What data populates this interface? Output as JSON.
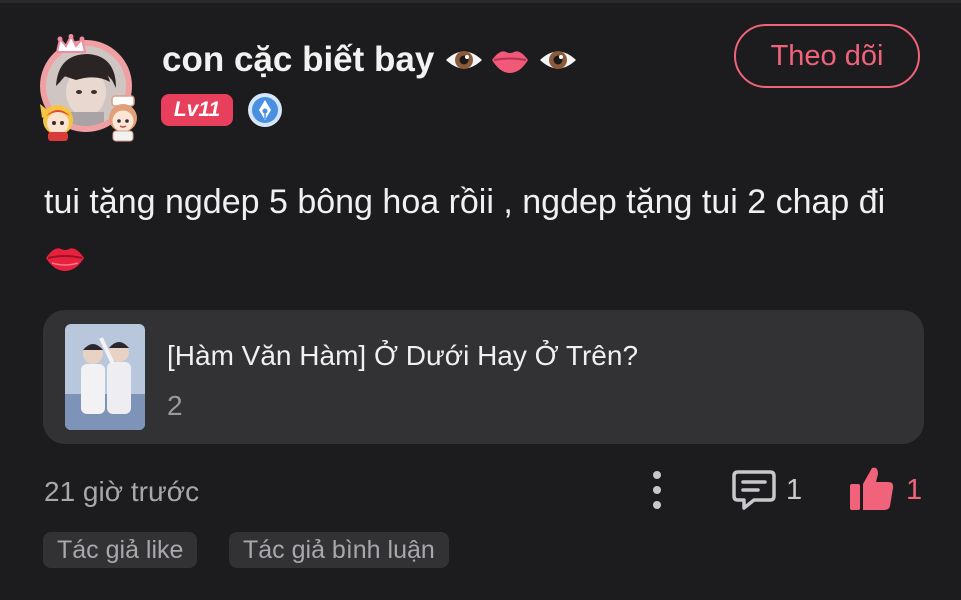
{
  "author": {
    "name": "con cặc biết bay",
    "name_emojis": [
      "eye-icon",
      "lips-icon",
      "eye-icon"
    ],
    "level": "Lv11",
    "verified_icon": "pen-nib-badge-icon"
  },
  "follow": {
    "label": "Theo dõi"
  },
  "post": {
    "text": "tui tặng ngdep 5 bông hoa rồii , ngdep tặng tui 2 chap đi",
    "trailing_emoji": "kiss-mark-icon"
  },
  "work": {
    "title": "[Hàm Văn Hàm] Ở Dưới Hay Ở Trên?",
    "chapter": "2"
  },
  "footer": {
    "time": "21 giờ trước",
    "comment_count": "1",
    "like_count": "1",
    "tags": [
      "Tác giả like",
      "Tác giả bình luận"
    ]
  },
  "colors": {
    "background": "#1c1b1d",
    "card": "#323134",
    "accent": "#f0637a",
    "level_badge": "#e8405c",
    "verified": "#4a90e2"
  }
}
